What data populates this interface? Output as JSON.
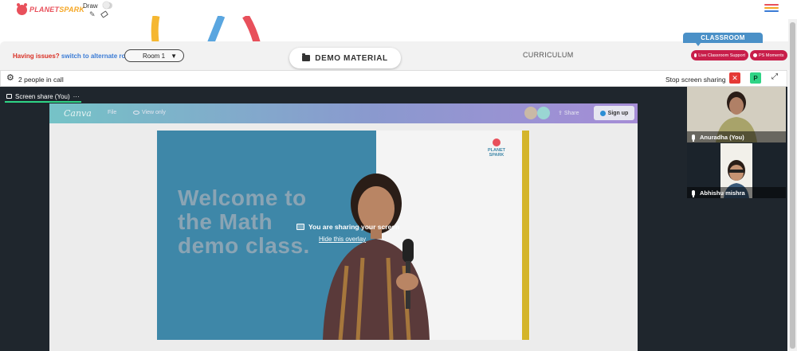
{
  "header": {
    "logo_text_a": "PLANET",
    "logo_text_b": "SPARK",
    "draw_label": "Draw",
    "menu_colors": [
      "#e8505b",
      "#f5a623",
      "#3a7bd5"
    ]
  },
  "roombar": {
    "issues_question": "Having issues?",
    "issues_link": "switch to alternate room",
    "room_select_value": "Room 1",
    "demo_material_label": "DEMO MATERIAL",
    "curriculum_label": "CURRICULUM",
    "classroom_label": "CLASSROOM",
    "live_support_label": "Live Classroom Support",
    "ps_moments_label": "PS Moments"
  },
  "callbar": {
    "people_count": "2 people in call",
    "stop_sharing_label": "Stop screen sharing",
    "close_label": "✕",
    "p_label": "P"
  },
  "stage": {
    "share_tab_label": "Screen share (You)",
    "share_tab_more": "···",
    "overlay_message": "You are sharing your screen",
    "overlay_hide": "Hide this overlay"
  },
  "canva": {
    "logo": "Canva",
    "file": "File",
    "view_only": "View only",
    "share": "Share",
    "signup": "Sign up",
    "slide_title": "Welcome to\nthe Math\ndemo class.",
    "slide_logo_a": "PLANET",
    "slide_logo_b": "SPARK"
  },
  "participants": [
    {
      "name": "Anuradha (You)"
    },
    {
      "name": "Abhishu mishra"
    }
  ],
  "colors": {
    "accent_green": "#2fd486",
    "danger_red": "#e53935",
    "brand_pink": "#c81e4a",
    "classroom_blue": "#4a90c7"
  }
}
